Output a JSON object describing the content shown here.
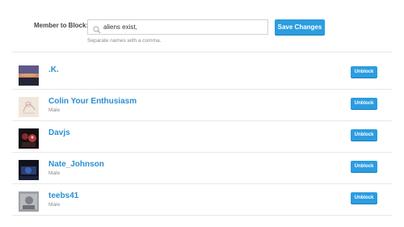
{
  "block_form": {
    "label": "Member to Block:",
    "input_value": "aliens exist,",
    "hint": "Separate names with a comma.",
    "save_label": "Save Changes"
  },
  "blocked_users": [
    {
      "name": ".K.",
      "gender": "",
      "unblock_label": "Unblock",
      "avatar": "dusk-landscape"
    },
    {
      "name": "Colin Your Enthusiasm",
      "gender": "Male",
      "unblock_label": "Unblock",
      "avatar": "sketch-drawing"
    },
    {
      "name": "Davjs",
      "gender": "",
      "unblock_label": "Unblock",
      "avatar": "dark-red-figures"
    },
    {
      "name": "Nate_Johnson",
      "gender": "Male",
      "unblock_label": "Unblock",
      "avatar": "blue-dark-scene"
    },
    {
      "name": "teebs41",
      "gender": "Male",
      "unblock_label": "Unblock",
      "avatar": "grey-photo"
    }
  ],
  "colors": {
    "accent": "#2b9de0",
    "link": "#2b8fcf"
  }
}
